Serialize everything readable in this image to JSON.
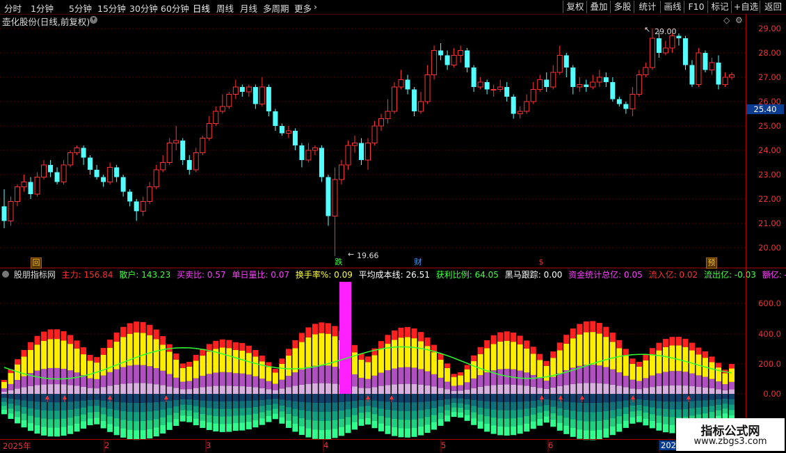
{
  "toolbar": {
    "periods": [
      "分时",
      "1分钟",
      "5分钟",
      "15分钟",
      "30分钟",
      "60分钟",
      "日线",
      "周线",
      "月线",
      "多周期",
      "更多"
    ],
    "active_period": "日线",
    "more_chevron": "›",
    "right_buttons": [
      "复权",
      "叠加",
      "多股",
      "统计",
      "画线",
      "F10",
      "标记",
      "+自选",
      "返回"
    ]
  },
  "stock_title": "壶化股份(日线,前复权)",
  "price_axis": {
    "labels": [
      "29.00",
      "28.00",
      "27.00",
      "26.00",
      "25.00",
      "24.00",
      "23.00",
      "22.00",
      "21.00",
      "20.00"
    ],
    "current_price": "25.40"
  },
  "price_annotations": {
    "high": "29.00",
    "low": "19.66"
  },
  "event_markers": [
    {
      "label": "回",
      "color": "#f0c020",
      "bg": "#553300"
    },
    {
      "label": "跌",
      "color": "#40ff40",
      "bg": ""
    },
    {
      "label": "财",
      "color": "#40a0ff",
      "bg": ""
    },
    {
      "label": "$",
      "color": "#ff3030",
      "bg": ""
    },
    {
      "label": "预",
      "color": "#f0c020",
      "bg": "#553300"
    }
  ],
  "indicator": {
    "name": "股朋指标网",
    "values": [
      {
        "label": "主力: 156.84",
        "color": "#ff3030"
      },
      {
        "label": "散户: 143.23",
        "color": "#40ff40"
      },
      {
        "label": "买卖比: 0.57",
        "color": "#ff40ff"
      },
      {
        "label": "单日量比: 0.07",
        "color": "#ff40ff"
      },
      {
        "label": "换手率%: 0.09",
        "color": "#ffff40"
      },
      {
        "label": "平均成本线: 26.51",
        "color": "#ffffff"
      },
      {
        "label": "获利比例: 64.05",
        "color": "#40ff40"
      },
      {
        "label": "黑马跟踪: 0.00",
        "color": "#ffffff"
      },
      {
        "label": "资金统计总亿: 0.05",
        "color": "#ff40ff"
      },
      {
        "label": "流入亿: 0.02",
        "color": "#ff3030"
      },
      {
        "label": "流出亿: -0.03",
        "color": "#40ff40"
      },
      {
        "label": "额亿: -0.01",
        "color": "#ff40ff"
      }
    ],
    "axis_labels": [
      "600.0",
      "400.0",
      "200.0",
      "0.00"
    ]
  },
  "date_axis": [
    "2025年",
    "2",
    "3",
    "4",
    "5",
    "6",
    "2025"
  ],
  "watermark": {
    "line1": "指标公式网",
    "line2": "www.zbgs3.com"
  },
  "colors": {
    "up": "#ff3333",
    "down": "#54ffff",
    "axis": "#aa0000",
    "grid": "#550000"
  },
  "chart_data": {
    "type": "candlestick",
    "ylim": [
      19.5,
      29.4
    ],
    "candles": [
      [
        21.7,
        21.1,
        22.4,
        20.8
      ],
      [
        21.1,
        21.9,
        22.1,
        20.9
      ],
      [
        21.9,
        22.5,
        22.6,
        21.7
      ],
      [
        22.5,
        22.7,
        23.0,
        22.3
      ],
      [
        22.7,
        22.2,
        22.9,
        22.0
      ],
      [
        22.2,
        22.9,
        23.1,
        22.1
      ],
      [
        22.9,
        23.4,
        23.6,
        22.8
      ],
      [
        23.4,
        23.1,
        23.6,
        22.9
      ],
      [
        23.1,
        22.7,
        23.3,
        22.6
      ],
      [
        22.7,
        23.4,
        23.6,
        22.6
      ],
      [
        23.4,
        23.9,
        24.0,
        23.3
      ],
      [
        23.9,
        24.1,
        24.2,
        23.8
      ],
      [
        24.1,
        23.7,
        24.2,
        23.4
      ],
      [
        23.7,
        23.2,
        23.8,
        23.0
      ],
      [
        23.2,
        22.9,
        23.4,
        22.8
      ],
      [
        22.9,
        22.7,
        23.0,
        22.5
      ],
      [
        22.7,
        23.3,
        23.5,
        22.6
      ],
      [
        23.3,
        22.9,
        23.4,
        22.7
      ],
      [
        22.9,
        22.3,
        23.0,
        22.1
      ],
      [
        22.3,
        21.9,
        22.4,
        21.7
      ],
      [
        21.9,
        21.5,
        22.0,
        21.1
      ],
      [
        21.5,
        21.9,
        22.1,
        21.3
      ],
      [
        21.9,
        22.5,
        22.7,
        21.8
      ],
      [
        22.5,
        23.2,
        23.4,
        22.4
      ],
      [
        23.2,
        23.5,
        23.8,
        23.1
      ],
      [
        23.5,
        24.3,
        24.5,
        23.4
      ],
      [
        24.3,
        24.4,
        25.0,
        24.0
      ],
      [
        24.4,
        23.6,
        24.5,
        23.4
      ],
      [
        23.6,
        23.2,
        23.8,
        23.0
      ],
      [
        23.2,
        23.9,
        24.1,
        23.1
      ],
      [
        23.9,
        24.5,
        24.6,
        23.8
      ],
      [
        24.5,
        25.1,
        25.4,
        24.4
      ],
      [
        25.1,
        25.6,
        25.8,
        25.0
      ],
      [
        25.6,
        25.8,
        26.3,
        25.5
      ],
      [
        25.8,
        26.3,
        26.4,
        25.7
      ],
      [
        26.3,
        26.6,
        26.9,
        26.1
      ],
      [
        26.6,
        26.4,
        26.7,
        26.2
      ],
      [
        26.4,
        26.6,
        26.7,
        26.2
      ],
      [
        26.6,
        25.9,
        26.7,
        25.7
      ],
      [
        25.9,
        26.6,
        27.0,
        25.8
      ],
      [
        26.6,
        25.6,
        26.7,
        25.4
      ],
      [
        25.6,
        25.0,
        25.7,
        24.8
      ],
      [
        25.0,
        24.7,
        25.1,
        24.6
      ],
      [
        24.7,
        24.8,
        25.0,
        24.5
      ],
      [
        24.8,
        24.2,
        24.9,
        24.0
      ],
      [
        24.2,
        23.6,
        24.3,
        23.3
      ],
      [
        23.6,
        24.0,
        24.3,
        23.5
      ],
      [
        24.0,
        24.1,
        24.2,
        23.8
      ],
      [
        24.1,
        22.9,
        24.2,
        22.7
      ],
      [
        22.9,
        21.3,
        23.0,
        20.9
      ],
      [
        21.3,
        22.8,
        23.3,
        19.66
      ],
      [
        22.8,
        23.4,
        23.6,
        22.6
      ],
      [
        23.4,
        24.2,
        24.4,
        23.2
      ],
      [
        24.2,
        24.3,
        24.6,
        23.9
      ],
      [
        24.3,
        23.6,
        24.5,
        23.4
      ],
      [
        23.6,
        24.3,
        24.5,
        23.2
      ],
      [
        24.3,
        25.0,
        25.2,
        24.2
      ],
      [
        25.0,
        25.3,
        25.5,
        24.8
      ],
      [
        25.3,
        25.6,
        26.1,
        25.1
      ],
      [
        25.6,
        26.6,
        26.8,
        25.5
      ],
      [
        26.6,
        26.9,
        27.3,
        26.5
      ],
      [
        26.9,
        26.5,
        27.1,
        26.3
      ],
      [
        26.5,
        25.6,
        26.6,
        25.4
      ],
      [
        25.6,
        26.0,
        26.4,
        25.5
      ],
      [
        26.0,
        27.1,
        27.5,
        25.9
      ],
      [
        27.1,
        28.1,
        28.3,
        26.9
      ],
      [
        28.1,
        27.9,
        28.4,
        27.7
      ],
      [
        27.9,
        27.5,
        28.1,
        27.3
      ],
      [
        27.5,
        27.9,
        28.2,
        27.4
      ],
      [
        27.9,
        28.1,
        28.3,
        27.6
      ],
      [
        28.1,
        27.4,
        28.2,
        27.2
      ],
      [
        27.4,
        26.6,
        27.5,
        26.4
      ],
      [
        26.6,
        26.8,
        27.0,
        26.5
      ],
      [
        26.8,
        26.5,
        26.9,
        26.3
      ],
      [
        26.5,
        26.5,
        26.7,
        26.2
      ],
      [
        26.5,
        26.6,
        26.9,
        26.4
      ],
      [
        26.6,
        26.2,
        26.8,
        26.0
      ],
      [
        26.2,
        25.5,
        26.3,
        25.3
      ],
      [
        25.5,
        25.6,
        25.8,
        25.3
      ],
      [
        25.6,
        26.0,
        26.3,
        25.5
      ],
      [
        26.0,
        26.5,
        26.8,
        25.9
      ],
      [
        26.5,
        26.9,
        27.1,
        26.4
      ],
      [
        26.9,
        26.6,
        27.2,
        26.4
      ],
      [
        26.6,
        27.2,
        27.5,
        26.5
      ],
      [
        27.2,
        27.9,
        28.3,
        27.1
      ],
      [
        27.9,
        27.4,
        28.0,
        27.0
      ],
      [
        27.4,
        26.6,
        27.5,
        26.3
      ],
      [
        26.6,
        26.7,
        27.0,
        26.4
      ],
      [
        26.7,
        26.6,
        26.9,
        26.4
      ],
      [
        26.6,
        26.8,
        27.1,
        26.5
      ],
      [
        26.8,
        27.0,
        27.3,
        26.6
      ],
      [
        27.0,
        26.8,
        27.2,
        26.6
      ],
      [
        26.8,
        26.1,
        27.0,
        26.0
      ],
      [
        26.1,
        25.9,
        26.2,
        25.8
      ],
      [
        25.9,
        25.7,
        26.0,
        25.5
      ],
      [
        25.7,
        26.3,
        26.6,
        25.4
      ],
      [
        26.3,
        27.1,
        27.3,
        26.2
      ],
      [
        27.1,
        27.4,
        27.6,
        27.0
      ],
      [
        27.4,
        28.6,
        29.0,
        27.3
      ],
      [
        28.6,
        28.0,
        28.9,
        27.8
      ],
      [
        28.0,
        28.2,
        28.5,
        27.9
      ],
      [
        28.2,
        28.7,
        28.8,
        28.0
      ],
      [
        28.7,
        28.6,
        28.8,
        28.3
      ],
      [
        28.6,
        27.5,
        28.7,
        27.3
      ],
      [
        27.5,
        26.7,
        27.7,
        26.6
      ],
      [
        26.7,
        28.0,
        28.2,
        26.6
      ],
      [
        28.0,
        27.3,
        28.1,
        27.2
      ],
      [
        27.3,
        27.6,
        27.8,
        27.1
      ],
      [
        27.6,
        26.7,
        27.9,
        26.5
      ],
      [
        26.7,
        27.0,
        27.2,
        26.6
      ],
      [
        27.0,
        27.1,
        27.2,
        26.9
      ]
    ]
  }
}
